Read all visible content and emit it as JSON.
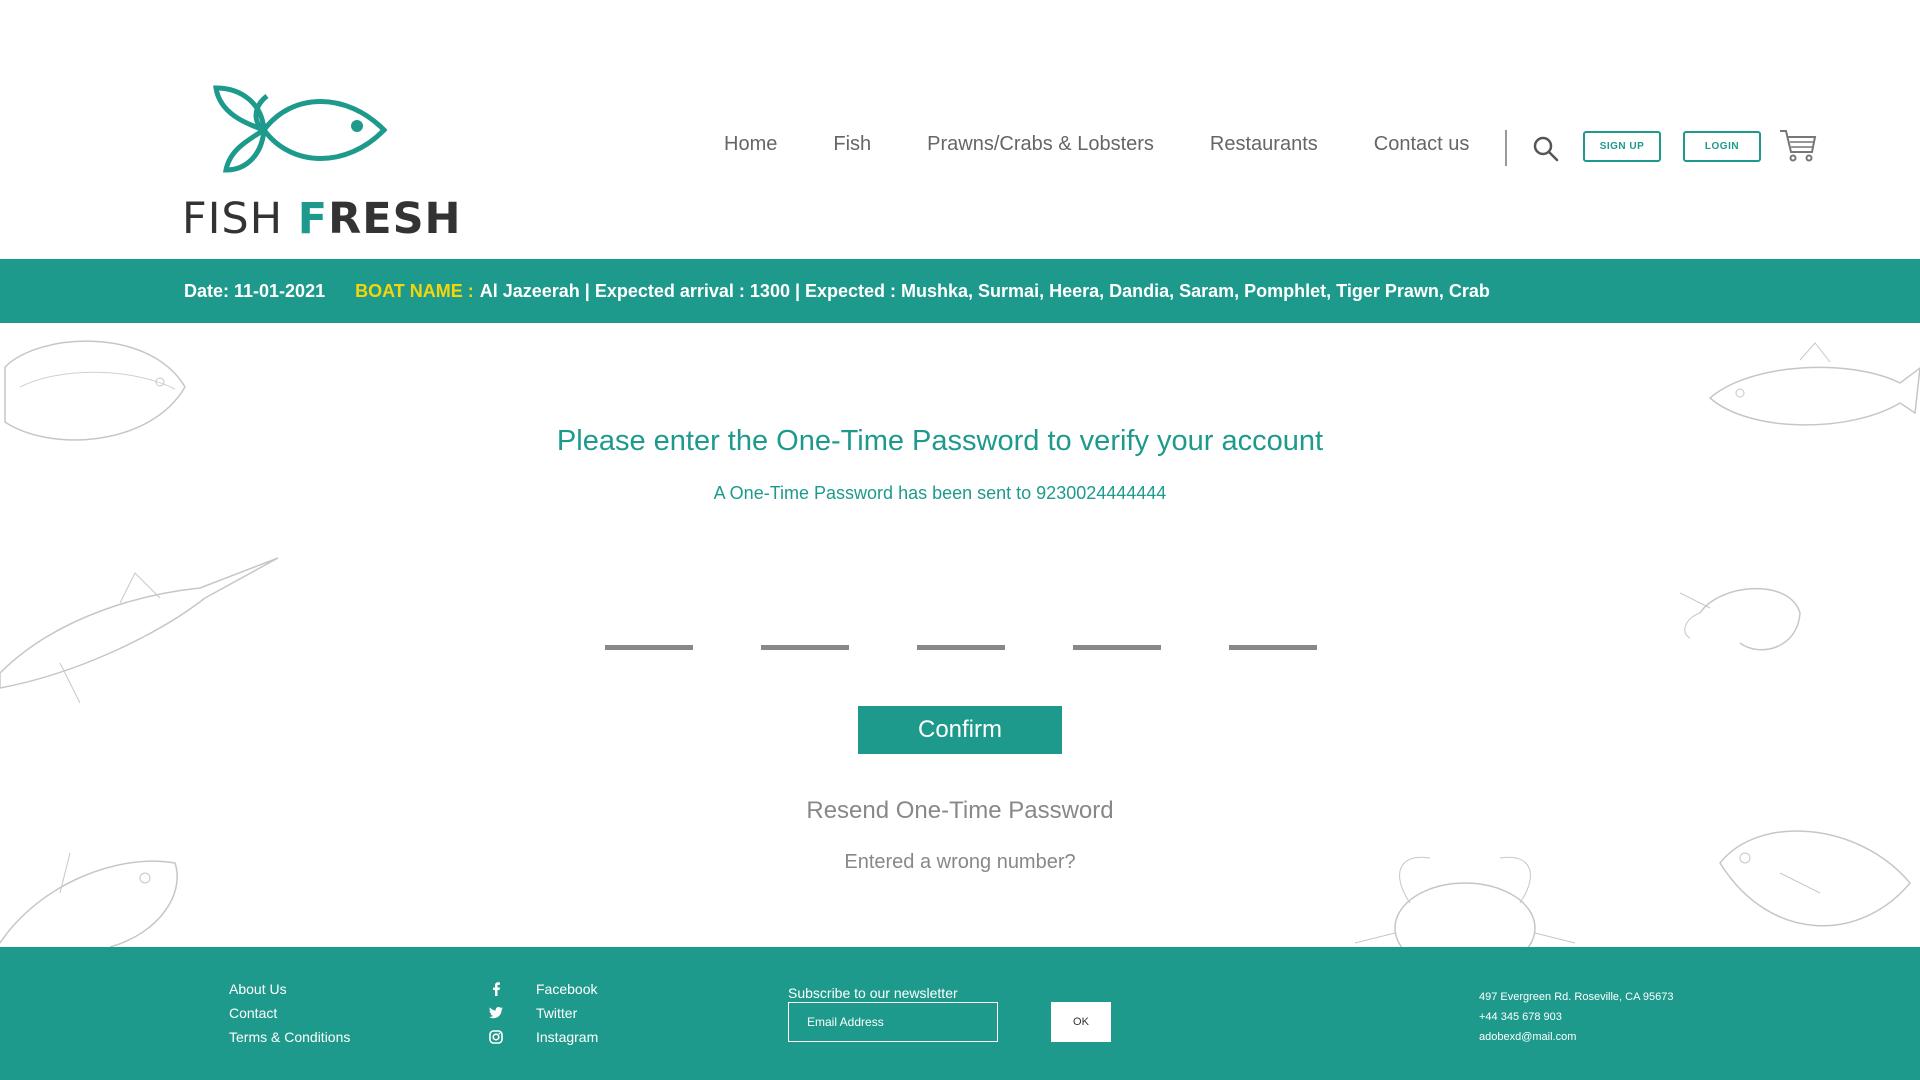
{
  "brand": {
    "word1": "FISH",
    "word2_accent": "F",
    "word2_rest": "RESH",
    "accent_color": "#1e9a8c"
  },
  "nav": {
    "items": [
      "Home",
      "Fish",
      "Prawns/Crabs & Lobsters",
      "Restaurants",
      "Contact us"
    ],
    "signup_label": "SIGN UP",
    "login_label": "LOGIN",
    "icons": [
      "search-icon",
      "cart-icon"
    ]
  },
  "ticker": {
    "date": "Date: 11-01-2021",
    "boat_label": "BOAT NAME :",
    "info": "Al Jazeerah | Expected arrival : 1300 | Expected : Mushka, Surmai, Heera, Dandia, Saram, Pomphlet, Tiger Prawn, Crab",
    "label_color": "#f5d60a"
  },
  "otp": {
    "title": "Please enter the One-Time Password to verify your account",
    "subtitle": "A One-Time Password has been sent to 9230024444444",
    "fields": 5,
    "confirm_label": "Confirm",
    "resend_label": "Resend One-Time Password",
    "wrong_number_label": "Entered a wrong number?"
  },
  "footer": {
    "links": [
      "About Us",
      "Contact",
      "Terms & Conditions"
    ],
    "social": [
      {
        "icon": "facebook-icon",
        "label": "Facebook"
      },
      {
        "icon": "twitter-icon",
        "label": "Twitter"
      },
      {
        "icon": "instagram-icon",
        "label": "Instagram"
      }
    ],
    "newsletter_label": "Subscribe to our newsletter",
    "email_placeholder": "Email Address",
    "ok_label": "OK",
    "address": "497 Evergreen Rd. Roseville, CA 95673",
    "phone": "+44 345 678 903",
    "email": "adobexd@mail.com"
  }
}
